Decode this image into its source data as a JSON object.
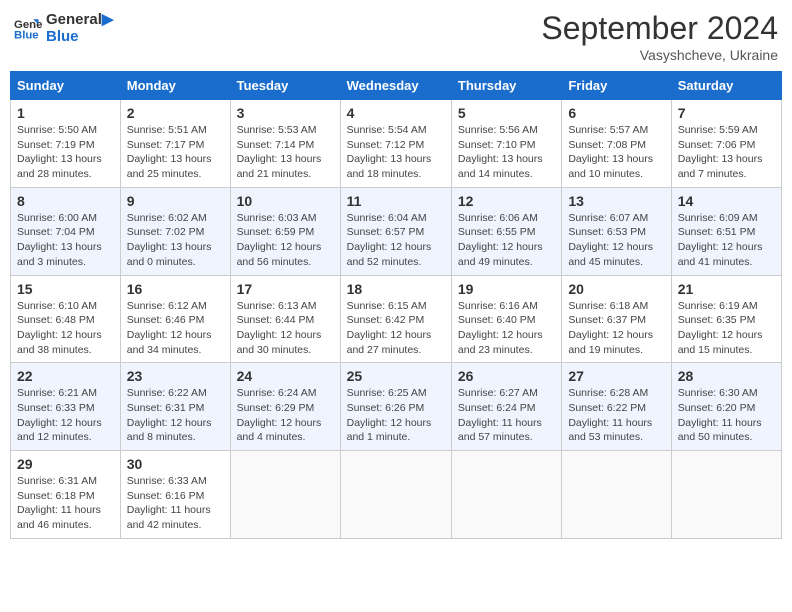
{
  "header": {
    "logo_line1": "General",
    "logo_line2": "Blue",
    "month": "September 2024",
    "location": "Vasyshcheve, Ukraine"
  },
  "weekdays": [
    "Sunday",
    "Monday",
    "Tuesday",
    "Wednesday",
    "Thursday",
    "Friday",
    "Saturday"
  ],
  "weeks": [
    [
      {
        "day": "1",
        "info": "Sunrise: 5:50 AM\nSunset: 7:19 PM\nDaylight: 13 hours\nand 28 minutes."
      },
      {
        "day": "2",
        "info": "Sunrise: 5:51 AM\nSunset: 7:17 PM\nDaylight: 13 hours\nand 25 minutes."
      },
      {
        "day": "3",
        "info": "Sunrise: 5:53 AM\nSunset: 7:14 PM\nDaylight: 13 hours\nand 21 minutes."
      },
      {
        "day": "4",
        "info": "Sunrise: 5:54 AM\nSunset: 7:12 PM\nDaylight: 13 hours\nand 18 minutes."
      },
      {
        "day": "5",
        "info": "Sunrise: 5:56 AM\nSunset: 7:10 PM\nDaylight: 13 hours\nand 14 minutes."
      },
      {
        "day": "6",
        "info": "Sunrise: 5:57 AM\nSunset: 7:08 PM\nDaylight: 13 hours\nand 10 minutes."
      },
      {
        "day": "7",
        "info": "Sunrise: 5:59 AM\nSunset: 7:06 PM\nDaylight: 13 hours\nand 7 minutes."
      }
    ],
    [
      {
        "day": "8",
        "info": "Sunrise: 6:00 AM\nSunset: 7:04 PM\nDaylight: 13 hours\nand 3 minutes."
      },
      {
        "day": "9",
        "info": "Sunrise: 6:02 AM\nSunset: 7:02 PM\nDaylight: 13 hours\nand 0 minutes."
      },
      {
        "day": "10",
        "info": "Sunrise: 6:03 AM\nSunset: 6:59 PM\nDaylight: 12 hours\nand 56 minutes."
      },
      {
        "day": "11",
        "info": "Sunrise: 6:04 AM\nSunset: 6:57 PM\nDaylight: 12 hours\nand 52 minutes."
      },
      {
        "day": "12",
        "info": "Sunrise: 6:06 AM\nSunset: 6:55 PM\nDaylight: 12 hours\nand 49 minutes."
      },
      {
        "day": "13",
        "info": "Sunrise: 6:07 AM\nSunset: 6:53 PM\nDaylight: 12 hours\nand 45 minutes."
      },
      {
        "day": "14",
        "info": "Sunrise: 6:09 AM\nSunset: 6:51 PM\nDaylight: 12 hours\nand 41 minutes."
      }
    ],
    [
      {
        "day": "15",
        "info": "Sunrise: 6:10 AM\nSunset: 6:48 PM\nDaylight: 12 hours\nand 38 minutes."
      },
      {
        "day": "16",
        "info": "Sunrise: 6:12 AM\nSunset: 6:46 PM\nDaylight: 12 hours\nand 34 minutes."
      },
      {
        "day": "17",
        "info": "Sunrise: 6:13 AM\nSunset: 6:44 PM\nDaylight: 12 hours\nand 30 minutes."
      },
      {
        "day": "18",
        "info": "Sunrise: 6:15 AM\nSunset: 6:42 PM\nDaylight: 12 hours\nand 27 minutes."
      },
      {
        "day": "19",
        "info": "Sunrise: 6:16 AM\nSunset: 6:40 PM\nDaylight: 12 hours\nand 23 minutes."
      },
      {
        "day": "20",
        "info": "Sunrise: 6:18 AM\nSunset: 6:37 PM\nDaylight: 12 hours\nand 19 minutes."
      },
      {
        "day": "21",
        "info": "Sunrise: 6:19 AM\nSunset: 6:35 PM\nDaylight: 12 hours\nand 15 minutes."
      }
    ],
    [
      {
        "day": "22",
        "info": "Sunrise: 6:21 AM\nSunset: 6:33 PM\nDaylight: 12 hours\nand 12 minutes."
      },
      {
        "day": "23",
        "info": "Sunrise: 6:22 AM\nSunset: 6:31 PM\nDaylight: 12 hours\nand 8 minutes."
      },
      {
        "day": "24",
        "info": "Sunrise: 6:24 AM\nSunset: 6:29 PM\nDaylight: 12 hours\nand 4 minutes."
      },
      {
        "day": "25",
        "info": "Sunrise: 6:25 AM\nSunset: 6:26 PM\nDaylight: 12 hours\nand 1 minute."
      },
      {
        "day": "26",
        "info": "Sunrise: 6:27 AM\nSunset: 6:24 PM\nDaylight: 11 hours\nand 57 minutes."
      },
      {
        "day": "27",
        "info": "Sunrise: 6:28 AM\nSunset: 6:22 PM\nDaylight: 11 hours\nand 53 minutes."
      },
      {
        "day": "28",
        "info": "Sunrise: 6:30 AM\nSunset: 6:20 PM\nDaylight: 11 hours\nand 50 minutes."
      }
    ],
    [
      {
        "day": "29",
        "info": "Sunrise: 6:31 AM\nSunset: 6:18 PM\nDaylight: 11 hours\nand 46 minutes."
      },
      {
        "day": "30",
        "info": "Sunrise: 6:33 AM\nSunset: 6:16 PM\nDaylight: 11 hours\nand 42 minutes."
      },
      {
        "day": "",
        "info": ""
      },
      {
        "day": "",
        "info": ""
      },
      {
        "day": "",
        "info": ""
      },
      {
        "day": "",
        "info": ""
      },
      {
        "day": "",
        "info": ""
      }
    ]
  ]
}
